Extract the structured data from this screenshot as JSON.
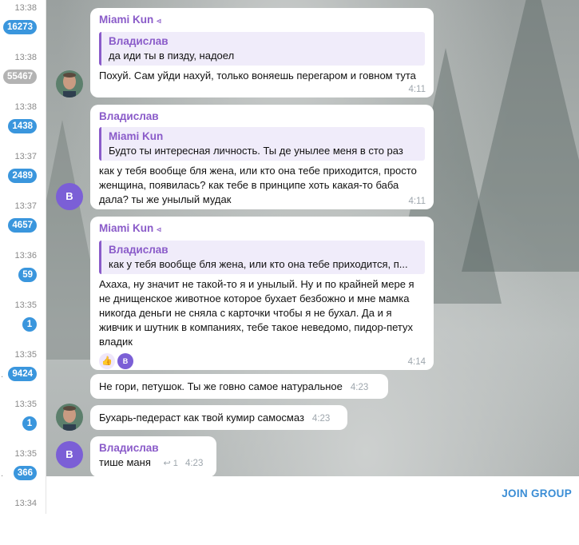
{
  "chats": [
    {
      "time": "13:38",
      "count": "16273",
      "color": "#3a96dd"
    },
    {
      "time": "13:38",
      "count": "55467",
      "color": "#b3b3b3"
    },
    {
      "time": "13:38",
      "count": "1438",
      "color": "#3a96dd"
    },
    {
      "time": "13:37",
      "count": "2489",
      "color": "#3a96dd"
    },
    {
      "time": "13:37",
      "count": "4657",
      "color": "#3a96dd"
    },
    {
      "time": "13:36",
      "count": "59",
      "color": "#3a96dd"
    },
    {
      "time": "13:35",
      "count": "1",
      "color": "#3a96dd"
    },
    {
      "time": "13:35",
      "count": "9424",
      "color": "#3a96dd"
    },
    {
      "time": "13:35",
      "count": "1",
      "color": "#3a96dd"
    },
    {
      "time": "13:35",
      "count": "366",
      "color": "#3a96dd"
    },
    {
      "time": "13:34",
      "count": "",
      "color": "#3a96dd"
    }
  ],
  "messages": {
    "m1": {
      "sender": "Miami Kun",
      "forward_icon": "forward-arrow-icon",
      "reply_name": "Владислав",
      "reply_text": "да иди ты в пизду, надоел",
      "text": "Похуй. Сам уйди нахуй, только воняешь перегаром и говном тута",
      "time": "4:11"
    },
    "m2": {
      "sender": "Владислав",
      "reply_name": "Miami Kun",
      "reply_text": "Будто ты интересная личность. Ты де унылее меня в сто раз",
      "text": "как у тебя вообще бля жена, или кто она тебе приходится, просто женщина, появилась? как тебе в принципе хоть какая-то баба дала? ты же унылый мудак",
      "time": "4:11",
      "avatar": "B"
    },
    "m3": {
      "sender": "Miami Kun",
      "forward_icon": "forward-arrow-icon",
      "reply_name": "Владислав",
      "reply_text": "как у тебя вообще бля жена, или кто она тебе приходится, п...",
      "text": "Ахаха, ну значит не такой-то я и унылый. Ну и по крайней мере я не днищенское животное которое бухает безбожно и мне мамка никогда деньги не сняла с карточки чтобы я не бухал. Да и я живчик и шутник в компаниях, тебе такое неведомо, пидор-петух владик",
      "reactions": [
        "👍",
        "B"
      ],
      "time": "4:14"
    },
    "m4": {
      "text": "Не гори, петушок. Ты же говно самое натуральное",
      "time": "4:23"
    },
    "m5": {
      "text": "Бухарь-педераст как твой кумир самосмаз",
      "time": "4:23"
    },
    "m6": {
      "sender": "Владислав",
      "text": "тише маня",
      "replies": "1",
      "time": "4:23",
      "avatar": "B"
    }
  },
  "footer": {
    "join_label": "JOIN GROUP"
  },
  "colors": {
    "accent": "#3a8dd5",
    "name": "#8a5bc9",
    "avatar": "#7b5fd6"
  }
}
